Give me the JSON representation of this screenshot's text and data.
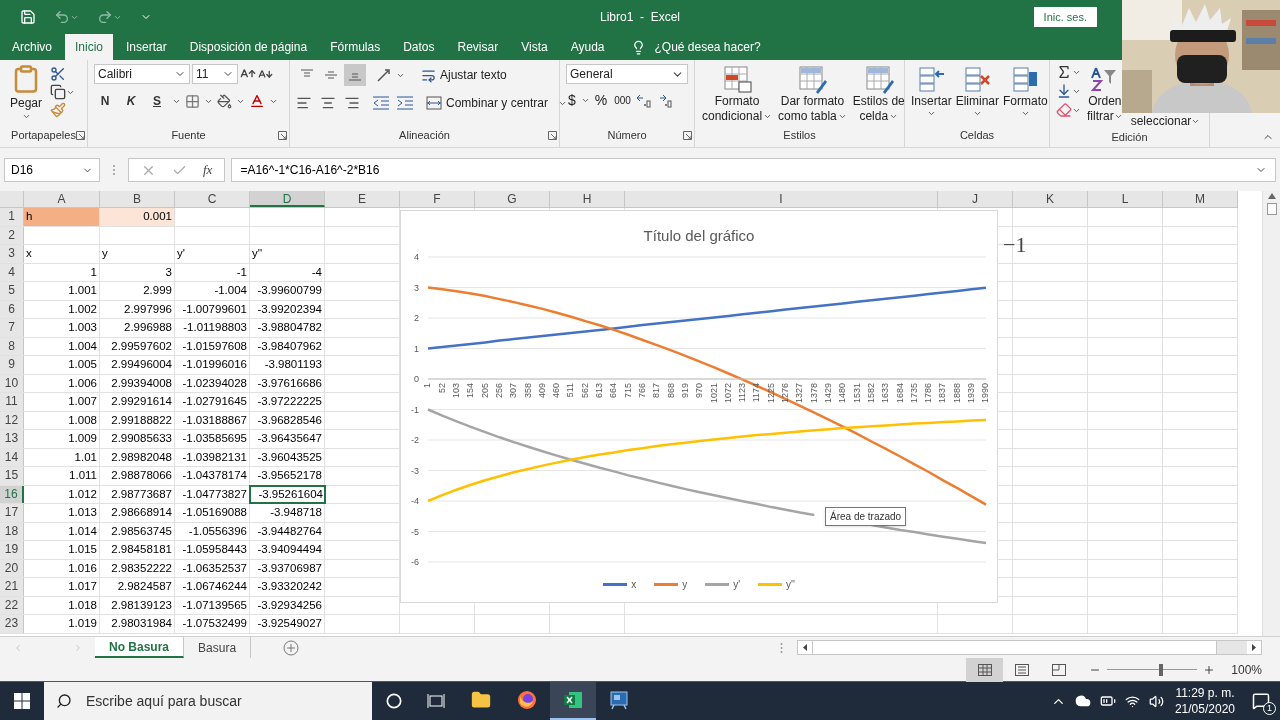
{
  "title_bar": {
    "title": "Libro1  -  Excel",
    "sign_in": "Inic. ses."
  },
  "menu_tabs": [
    {
      "label": "Archivo",
      "selected": false
    },
    {
      "label": "Inicio",
      "selected": true
    },
    {
      "label": "Insertar",
      "selected": false
    },
    {
      "label": "Disposición de página",
      "selected": false
    },
    {
      "label": "Fórmulas",
      "selected": false
    },
    {
      "label": "Datos",
      "selected": false
    },
    {
      "label": "Revisar",
      "selected": false
    },
    {
      "label": "Vista",
      "selected": false
    },
    {
      "label": "Ayuda",
      "selected": false
    }
  ],
  "tell_me": "¿Qué desea hacer?",
  "ribbon": {
    "clipboard": {
      "label": "Portapapeles",
      "paste": "Pegar"
    },
    "font": {
      "label": "Fuente",
      "name": "Calibri",
      "size": "11",
      "bold": "N",
      "italic": "K",
      "underline": "S"
    },
    "alignment": {
      "label": "Alineación",
      "vertical": [
        {
          "selected": false
        },
        {
          "selected": false
        },
        {
          "selected": true
        }
      ],
      "wrap": "Ajustar texto",
      "merge": "Combinar y centrar"
    },
    "number": {
      "label": "Número",
      "format": "General",
      "currency": "$",
      "percent": "%",
      "thousands": "000"
    },
    "styles": {
      "label": "Estilos",
      "items": [
        {
          "line1": "Formato",
          "line2": "condicional"
        },
        {
          "line1": "Dar formato",
          "line2": "como tabla"
        },
        {
          "line1": "Estilos de",
          "line2": "celda"
        }
      ]
    },
    "cells": {
      "label": "Celdas",
      "items": [
        "Insertar",
        "Eliminar",
        "Formato"
      ]
    },
    "editing": {
      "label": "Edición",
      "sort_line1": "Orden",
      "sort_line2": "filtrar",
      "find_line2": "seleccionar"
    }
  },
  "formula_bar": {
    "name_box": "D16",
    "function_label": "fx",
    "formula": "=A16^-1*C16-A16^-2*B16"
  },
  "columns": [
    {
      "label": "A",
      "selected": false
    },
    {
      "label": "B",
      "selected": false
    },
    {
      "label": "C",
      "selected": false
    },
    {
      "label": "D",
      "selected": true
    },
    {
      "label": "E",
      "selected": false
    },
    {
      "label": "F",
      "selected": false
    },
    {
      "label": "G",
      "selected": false
    },
    {
      "label": "H",
      "selected": false
    },
    {
      "label": "I",
      "selected": false
    },
    {
      "label": "J",
      "selected": false
    },
    {
      "label": "K",
      "selected": false
    },
    {
      "label": "L",
      "selected": false
    },
    {
      "label": "M",
      "selected": false
    }
  ],
  "rows": [
    {
      "number": "1",
      "selected": false,
      "cells": [
        "h",
        "0.001"
      ],
      "highlights": [
        {
          "color": "#f4b084"
        },
        {
          "color": "#fce4d6"
        }
      ]
    },
    {
      "number": "2",
      "selected": false
    },
    {
      "number": "3",
      "selected": false,
      "cells": [
        "x",
        "y",
        "y'",
        "y''"
      ]
    },
    {
      "number": "4",
      "selected": false,
      "cells": [
        "1",
        "3",
        "-1",
        "-4"
      ]
    },
    {
      "number": "5",
      "selected": false,
      "cells": [
        "1.001",
        "2.999",
        "-1.004",
        "-3.99600799"
      ]
    },
    {
      "number": "6",
      "selected": false,
      "cells": [
        "1.002",
        "2.997996",
        "-1.00799601",
        "-3.99202394"
      ]
    },
    {
      "number": "7",
      "selected": false,
      "cells": [
        "1.003",
        "2.996988",
        "-1.01198803",
        "-3.98804782"
      ]
    },
    {
      "number": "8",
      "selected": false,
      "cells": [
        "1.004",
        "2.99597602",
        "-1.01597608",
        "-3.98407962"
      ]
    },
    {
      "number": "9",
      "selected": false,
      "cells": [
        "1.005",
        "2.99496004",
        "-1.01996016",
        "-3.9801193"
      ]
    },
    {
      "number": "10",
      "selected": false,
      "cells": [
        "1.006",
        "2.99394008",
        "-1.02394028",
        "-3.97616686"
      ]
    },
    {
      "number": "11",
      "selected": false,
      "cells": [
        "1.007",
        "2.99291614",
        "-1.02791645",
        "-3.97222225"
      ]
    },
    {
      "number": "12",
      "selected": false,
      "cells": [
        "1.008",
        "2.99188822",
        "-1.03188867",
        "-3.96828546"
      ]
    },
    {
      "number": "13",
      "selected": false,
      "cells": [
        "1.009",
        "2.99085633",
        "-1.03585695",
        "-3.96435647"
      ]
    },
    {
      "number": "14",
      "selected": false,
      "cells": [
        "1.01",
        "2.98982048",
        "-1.03982131",
        "-3.96043525"
      ]
    },
    {
      "number": "15",
      "selected": false,
      "cells": [
        "1.011",
        "2.98878066",
        "-1.04378174",
        "-3.95652178"
      ]
    },
    {
      "number": "16",
      "selected": true,
      "cells": [
        "1.012",
        "2.98773687",
        "-1.04773827",
        "-3.95261604"
      ]
    },
    {
      "number": "17",
      "selected": false,
      "cells": [
        "1.013",
        "2.98668914",
        "-1.05169088",
        "-3.948718"
      ]
    },
    {
      "number": "18",
      "selected": false,
      "cells": [
        "1.014",
        "2.98563745",
        "-1.0556396",
        "-3.94482764"
      ]
    },
    {
      "number": "19",
      "selected": false,
      "cells": [
        "1.015",
        "2.98458181",
        "-1.05958443",
        "-3.94094494"
      ]
    },
    {
      "number": "20",
      "selected": false,
      "cells": [
        "1.016",
        "2.98352222",
        "-1.06352537",
        "-3.93706987"
      ]
    },
    {
      "number": "21",
      "selected": false,
      "cells": [
        "1.017",
        "2.9824587",
        "-1.06746244",
        "-3.93320242"
      ]
    },
    {
      "number": "22",
      "selected": false,
      "cells": [
        "1.018",
        "2.98139123",
        "-1.07139565",
        "-3.92934256"
      ]
    },
    {
      "number": "23",
      "selected": false,
      "cells": [
        "1.019",
        "2.98031984",
        "-1.07532499",
        "-3.92549027"
      ]
    }
  ],
  "floating_text": "−1",
  "chart": {
    "tooltip": "Área de trazado",
    "chart_data": {
      "type": "line",
      "title": "Título del gráfico",
      "grid": true,
      "legend": "bottom",
      "categories": [
        "1",
        "52",
        "103",
        "154",
        "205",
        "256",
        "307",
        "358",
        "409",
        "460",
        "511",
        "562",
        "613",
        "664",
        "715",
        "766",
        "817",
        "868",
        "919",
        "970",
        "1021",
        "1072",
        "1123",
        "1174",
        "1225",
        "1276",
        "1327",
        "1378",
        "1429",
        "1480",
        "1531",
        "1582",
        "1633",
        "1684",
        "1735",
        "1786",
        "1837",
        "1888",
        "1939",
        "1990"
      ],
      "ylim": [
        -6,
        4
      ],
      "yticks": [
        4,
        3,
        2,
        1,
        0,
        -1,
        -2,
        -3,
        -4,
        -5,
        -6
      ],
      "series": [
        {
          "name": "x",
          "color": "#4472c4",
          "values": [
            1.0,
            1.05,
            1.1,
            1.15,
            1.2,
            1.26,
            1.31,
            1.36,
            1.41,
            1.46,
            1.51,
            1.56,
            1.61,
            1.66,
            1.71,
            1.77,
            1.82,
            1.87,
            1.92,
            1.97,
            2.02,
            2.07,
            2.12,
            2.17,
            2.22,
            2.28,
            2.33,
            2.38,
            2.43,
            2.48,
            2.53,
            2.58,
            2.63,
            2.68,
            2.73,
            2.79,
            2.84,
            2.89,
            2.94,
            2.99
          ]
        },
        {
          "name": "y",
          "color": "#ed7d31",
          "values": [
            3.0,
            2.94,
            2.88,
            2.8,
            2.72,
            2.62,
            2.52,
            2.41,
            2.3,
            2.17,
            2.04,
            1.9,
            1.76,
            1.61,
            1.45,
            1.28,
            1.11,
            0.94,
            0.76,
            0.57,
            0.38,
            0.18,
            -0.02,
            -0.23,
            -0.44,
            -0.66,
            -0.88,
            -1.1,
            -1.33,
            -1.56,
            -1.8,
            -2.05,
            -2.29,
            -2.54,
            -2.8,
            -3.05,
            -3.32,
            -3.58,
            -3.85,
            -4.12
          ]
        },
        {
          "name": "y'",
          "color": "#a5a5a5",
          "values": [
            -1.0,
            -1.2,
            -1.39,
            -1.57,
            -1.74,
            -1.91,
            -2.07,
            -2.22,
            -2.37,
            -2.51,
            -2.65,
            -2.78,
            -2.91,
            -3.03,
            -3.16,
            -3.27,
            -3.39,
            -3.5,
            -3.61,
            -3.71,
            -3.81,
            -3.91,
            -4.01,
            -4.1,
            -4.2,
            -4.29,
            -4.38,
            -4.46,
            null,
            null,
            null,
            -4.79,
            -4.87,
            -4.95,
            -5.02,
            -5.1,
            -5.17,
            -5.24,
            -5.31,
            -5.38
          ]
        },
        {
          "name": "y''",
          "color": "#ffc000",
          "values": [
            -4.0,
            -3.81,
            -3.63,
            -3.47,
            -3.32,
            -3.19,
            -3.06,
            -2.95,
            -2.84,
            -2.74,
            -2.65,
            -2.56,
            -2.48,
            -2.41,
            -2.33,
            -2.27,
            -2.2,
            -2.14,
            -2.09,
            -2.03,
            -1.98,
            -1.93,
            -1.89,
            -1.84,
            -1.8,
            -1.76,
            -1.72,
            -1.68,
            -1.65,
            -1.61,
            -1.58,
            -1.55,
            -1.52,
            -1.49,
            -1.46,
            -1.44,
            -1.41,
            -1.39,
            -1.36,
            -1.34
          ]
        }
      ]
    }
  },
  "sheet_tabs": [
    {
      "label": "No Basura",
      "selected": true
    },
    {
      "label": "Basura",
      "selected": false
    }
  ],
  "status_bar": {
    "views": [
      {
        "selected": true
      },
      {
        "selected": false
      },
      {
        "selected": false
      }
    ],
    "zoom_slider": {
      "level": 0.6
    },
    "zoom": "100%"
  },
  "taskbar": {
    "search_placeholder": "Escribe aquí para buscar",
    "apps": [
      {
        "kind": "explorer",
        "active": false
      },
      {
        "kind": "firefox",
        "active": false
      },
      {
        "kind": "excel",
        "active": true
      },
      {
        "kind": "paint",
        "active": false
      }
    ],
    "time": "11:29 p. m.",
    "date": "21/05/2020",
    "notifications": "1"
  }
}
